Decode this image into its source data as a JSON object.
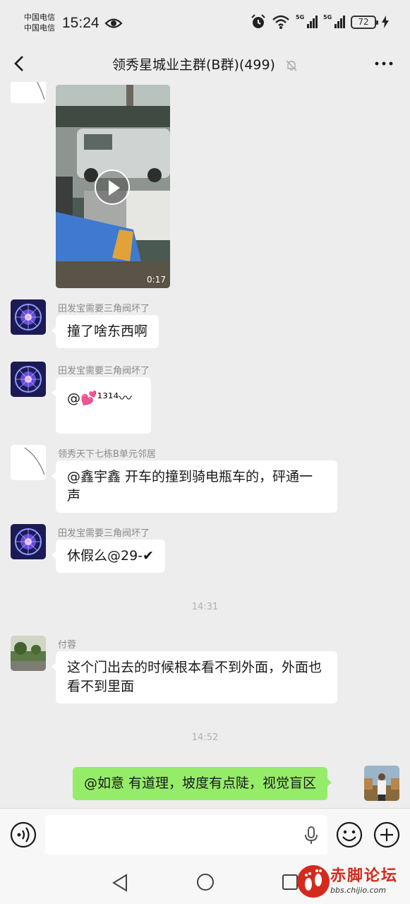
{
  "status": {
    "carrier1": "中国电信",
    "carrier2": "中国电信",
    "time": "15:24",
    "network1": "5G",
    "network2": "5G",
    "battery": "72"
  },
  "nav": {
    "title": "领秀星城业主群(B群)(499)"
  },
  "messages": {
    "video_duration": "0:17",
    "m1": {
      "sender": "田发宝需要三角阀坏了",
      "text": "撞了啥东西啊"
    },
    "m2": {
      "sender": "田发宝需要三角阀坏了",
      "text": "@💕¹³¹⁴〰"
    },
    "m3": {
      "sender": "领秀天下七栋B单元邻居",
      "text": "@鑫宇鑫  开车的撞到骑电瓶车的，砰通一声"
    },
    "m4": {
      "sender": "田发宝需要三角阀坏了",
      "text": "休假么@29-✔"
    },
    "ts1": "14:31",
    "m5": {
      "sender": "付蓉",
      "text": "这个门出去的时候根本看不到外面，外面也看不到里面"
    },
    "ts2": "14:52",
    "m6": {
      "text": "@如意  有道理，坡度有点陡，视觉盲区"
    }
  },
  "input": {
    "value": ""
  },
  "watermark": {
    "text": "赤脚论坛",
    "url": "bbs.chijio.com"
  },
  "colors": {
    "background": "#ededed",
    "mine_bubble": "#95ec69",
    "watermark": "#d42a1e"
  }
}
